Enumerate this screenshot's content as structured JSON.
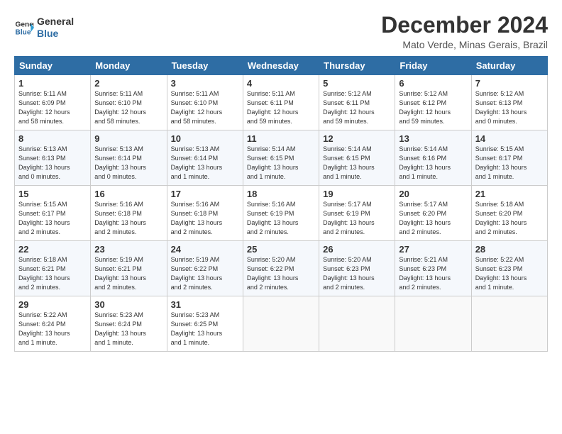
{
  "header": {
    "logo_line1": "General",
    "logo_line2": "Blue",
    "month_year": "December 2024",
    "location": "Mato Verde, Minas Gerais, Brazil"
  },
  "days_of_week": [
    "Sunday",
    "Monday",
    "Tuesday",
    "Wednesday",
    "Thursday",
    "Friday",
    "Saturday"
  ],
  "weeks": [
    [
      {
        "day": "1",
        "info": "Sunrise: 5:11 AM\nSunset: 6:09 PM\nDaylight: 12 hours\nand 58 minutes."
      },
      {
        "day": "2",
        "info": "Sunrise: 5:11 AM\nSunset: 6:10 PM\nDaylight: 12 hours\nand 58 minutes."
      },
      {
        "day": "3",
        "info": "Sunrise: 5:11 AM\nSunset: 6:10 PM\nDaylight: 12 hours\nand 58 minutes."
      },
      {
        "day": "4",
        "info": "Sunrise: 5:11 AM\nSunset: 6:11 PM\nDaylight: 12 hours\nand 59 minutes."
      },
      {
        "day": "5",
        "info": "Sunrise: 5:12 AM\nSunset: 6:11 PM\nDaylight: 12 hours\nand 59 minutes."
      },
      {
        "day": "6",
        "info": "Sunrise: 5:12 AM\nSunset: 6:12 PM\nDaylight: 12 hours\nand 59 minutes."
      },
      {
        "day": "7",
        "info": "Sunrise: 5:12 AM\nSunset: 6:13 PM\nDaylight: 13 hours\nand 0 minutes."
      }
    ],
    [
      {
        "day": "8",
        "info": "Sunrise: 5:13 AM\nSunset: 6:13 PM\nDaylight: 13 hours\nand 0 minutes."
      },
      {
        "day": "9",
        "info": "Sunrise: 5:13 AM\nSunset: 6:14 PM\nDaylight: 13 hours\nand 0 minutes."
      },
      {
        "day": "10",
        "info": "Sunrise: 5:13 AM\nSunset: 6:14 PM\nDaylight: 13 hours\nand 1 minute."
      },
      {
        "day": "11",
        "info": "Sunrise: 5:14 AM\nSunset: 6:15 PM\nDaylight: 13 hours\nand 1 minute."
      },
      {
        "day": "12",
        "info": "Sunrise: 5:14 AM\nSunset: 6:15 PM\nDaylight: 13 hours\nand 1 minute."
      },
      {
        "day": "13",
        "info": "Sunrise: 5:14 AM\nSunset: 6:16 PM\nDaylight: 13 hours\nand 1 minute."
      },
      {
        "day": "14",
        "info": "Sunrise: 5:15 AM\nSunset: 6:17 PM\nDaylight: 13 hours\nand 1 minute."
      }
    ],
    [
      {
        "day": "15",
        "info": "Sunrise: 5:15 AM\nSunset: 6:17 PM\nDaylight: 13 hours\nand 2 minutes."
      },
      {
        "day": "16",
        "info": "Sunrise: 5:16 AM\nSunset: 6:18 PM\nDaylight: 13 hours\nand 2 minutes."
      },
      {
        "day": "17",
        "info": "Sunrise: 5:16 AM\nSunset: 6:18 PM\nDaylight: 13 hours\nand 2 minutes."
      },
      {
        "day": "18",
        "info": "Sunrise: 5:16 AM\nSunset: 6:19 PM\nDaylight: 13 hours\nand 2 minutes."
      },
      {
        "day": "19",
        "info": "Sunrise: 5:17 AM\nSunset: 6:19 PM\nDaylight: 13 hours\nand 2 minutes."
      },
      {
        "day": "20",
        "info": "Sunrise: 5:17 AM\nSunset: 6:20 PM\nDaylight: 13 hours\nand 2 minutes."
      },
      {
        "day": "21",
        "info": "Sunrise: 5:18 AM\nSunset: 6:20 PM\nDaylight: 13 hours\nand 2 minutes."
      }
    ],
    [
      {
        "day": "22",
        "info": "Sunrise: 5:18 AM\nSunset: 6:21 PM\nDaylight: 13 hours\nand 2 minutes."
      },
      {
        "day": "23",
        "info": "Sunrise: 5:19 AM\nSunset: 6:21 PM\nDaylight: 13 hours\nand 2 minutes."
      },
      {
        "day": "24",
        "info": "Sunrise: 5:19 AM\nSunset: 6:22 PM\nDaylight: 13 hours\nand 2 minutes."
      },
      {
        "day": "25",
        "info": "Sunrise: 5:20 AM\nSunset: 6:22 PM\nDaylight: 13 hours\nand 2 minutes."
      },
      {
        "day": "26",
        "info": "Sunrise: 5:20 AM\nSunset: 6:23 PM\nDaylight: 13 hours\nand 2 minutes."
      },
      {
        "day": "27",
        "info": "Sunrise: 5:21 AM\nSunset: 6:23 PM\nDaylight: 13 hours\nand 2 minutes."
      },
      {
        "day": "28",
        "info": "Sunrise: 5:22 AM\nSunset: 6:23 PM\nDaylight: 13 hours\nand 1 minute."
      }
    ],
    [
      {
        "day": "29",
        "info": "Sunrise: 5:22 AM\nSunset: 6:24 PM\nDaylight: 13 hours\nand 1 minute."
      },
      {
        "day": "30",
        "info": "Sunrise: 5:23 AM\nSunset: 6:24 PM\nDaylight: 13 hours\nand 1 minute."
      },
      {
        "day": "31",
        "info": "Sunrise: 5:23 AM\nSunset: 6:25 PM\nDaylight: 13 hours\nand 1 minute."
      },
      {
        "day": "",
        "info": ""
      },
      {
        "day": "",
        "info": ""
      },
      {
        "day": "",
        "info": ""
      },
      {
        "day": "",
        "info": ""
      }
    ]
  ]
}
